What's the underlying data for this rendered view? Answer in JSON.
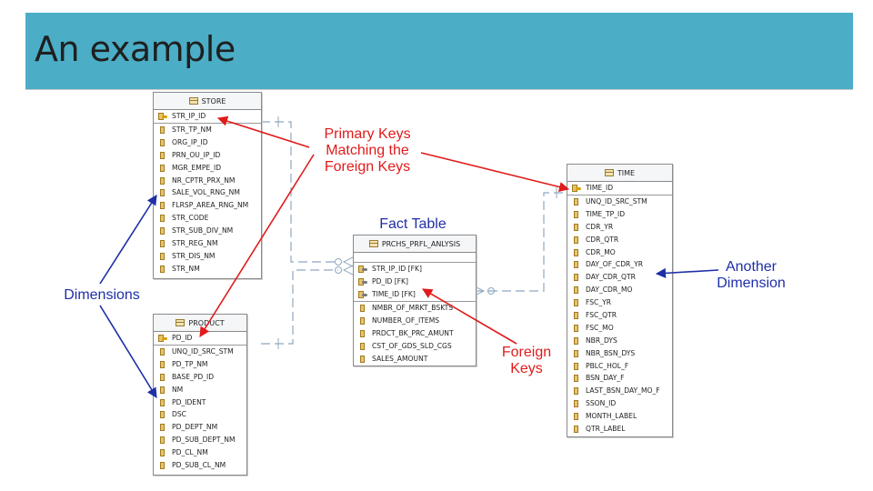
{
  "slide": {
    "title": "An example"
  },
  "tables": {
    "store": {
      "name": "STORE",
      "key_columns": [
        "STR_IP_ID"
      ],
      "columns": [
        "STR_TP_NM",
        "ORG_IP_ID",
        "PRN_OU_IP_ID",
        "MGR_EMPE_ID",
        "NR_CPTR_PRX_NM",
        "SALE_VOL_RNG_NM",
        "FLRSP_AREA_RNG_NM",
        "STR_CODE",
        "STR_SUB_DIV_NM",
        "STR_REG_NM",
        "STR_DIS_NM",
        "STR_NM"
      ]
    },
    "product": {
      "name": "PRODUCT",
      "key_columns": [
        "PD_ID"
      ],
      "columns": [
        "UNQ_ID_SRC_STM",
        "PD_TP_NM",
        "BASE_PD_ID",
        "NM",
        "PD_IDENT",
        "DSC",
        "PD_DEPT_NM",
        "PD_SUB_DEPT_NM",
        "PD_CL_NM",
        "PD_SUB_CL_NM"
      ]
    },
    "fact": {
      "name": "PRCHS_PRFL_ANLYSIS",
      "key_columns": [
        "STR_IP_ID [FK]",
        "PD_ID [FK]",
        "TIME_ID [FK]"
      ],
      "columns": [
        "NMBR_OF_MRKT_BSKTS",
        "NUMBER_OF_ITEMS",
        "PRDCT_BK_PRC_AMUNT",
        "CST_OF_GDS_SLD_CGS",
        "SALES_AMOUNT"
      ]
    },
    "time": {
      "name": "TIME",
      "key_columns": [
        "TIME_ID"
      ],
      "columns": [
        "UNQ_ID_SRC_STM",
        "TIME_TP_ID",
        "CDR_YR",
        "CDR_QTR",
        "CDR_MO",
        "DAY_OF_CDR_YR",
        "DAY_CDR_QTR",
        "DAY_CDR_MO",
        "FSC_YR",
        "FSC_QTR",
        "FSC_MO",
        "NBR_DYS",
        "NBR_BSN_DYS",
        "PBLC_HOL_F",
        "BSN_DAY_F",
        "LAST_BSN_DAY_MO_F",
        "SSON_ID",
        "MONTH_LABEL",
        "QTR_LABEL"
      ]
    }
  },
  "annotations": {
    "primary_keys": [
      "Primary Keys",
      "Matching the",
      "Foreign Keys"
    ],
    "fact_table": "Fact Table",
    "dimensions": "Dimensions",
    "another_dimension": [
      "Another",
      "Dimension"
    ],
    "foreign_keys": [
      "Foreign",
      "Keys"
    ]
  },
  "colors": {
    "header": "#4badc6",
    "red_arrow": "#e01b1b",
    "blue_arrow": "#1f2fa8",
    "connector": "#8fa8c0"
  }
}
